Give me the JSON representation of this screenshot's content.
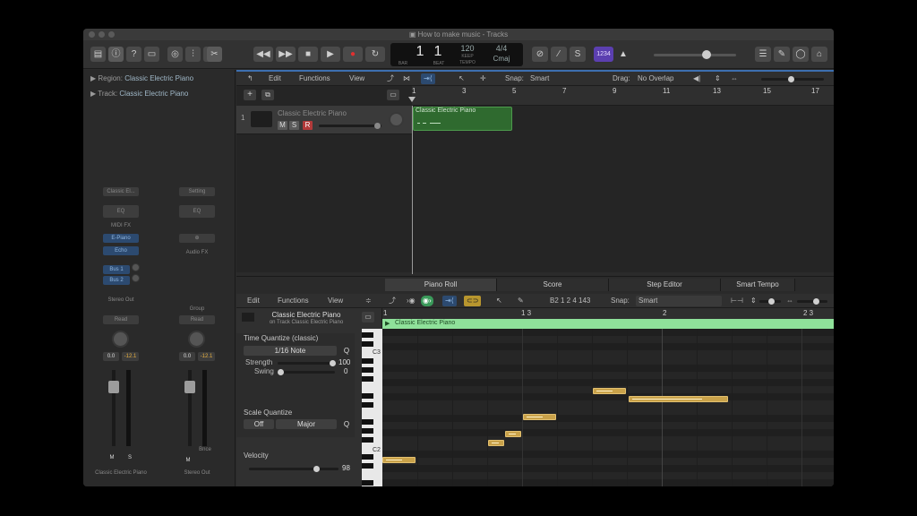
{
  "window": {
    "title": "How to make music - Tracks"
  },
  "lcd": {
    "bar": "1",
    "beat": "1",
    "tempo": "120",
    "tempo_label": "KEEP",
    "signature": "4/4",
    "key": "Cmaj",
    "bar_label": "BAR",
    "beat_label": "BEAT",
    "tempo_lab": "TEMPO"
  },
  "cpu_badge": "1234",
  "inspector": {
    "region_label": "Region:",
    "region_value": "Classic Electric Piano",
    "track_label": "Track:",
    "track_value": "Classic Electric Piano",
    "strip1": {
      "name": "Classic Electric Piano",
      "setting": "Classic El...",
      "eq": "EQ",
      "midi_fx": "MIDI FX",
      "plugin1": "E-Piano",
      "plugin2": "Echo",
      "send1": "Bus 1",
      "send2": "Bus 2",
      "output": "Stereo Out",
      "mode": "Read",
      "vol": "0.0",
      "peak": "-12.1",
      "mute": "M",
      "solo": "S"
    },
    "strip2": {
      "name": "Stereo Out",
      "setting": "Setting",
      "eq": "EQ",
      "link": "⊕",
      "audio_fx": "Audio FX",
      "group": "Group",
      "mode": "Read",
      "vol": "0.0",
      "peak": "-12.1",
      "mute": "M",
      "bnce": "Bnce"
    }
  },
  "tracks_toolbar": {
    "edit": "Edit",
    "functions": "Functions",
    "view": "View",
    "snap_label": "Snap:",
    "snap_value": "Smart",
    "drag_label": "Drag:",
    "drag_value": "No Overlap"
  },
  "ruler_marks": [
    "1",
    "3",
    "5",
    "7",
    "9",
    "11",
    "13",
    "15",
    "17"
  ],
  "track": {
    "number": "1",
    "name": "Classic Electric Piano",
    "m": "M",
    "s": "S",
    "r": "R"
  },
  "region_name": "Classic Electric Piano",
  "editor_tabs": [
    "Piano Roll",
    "Score",
    "Step Editor",
    "Smart Tempo"
  ],
  "pr_toolbar": {
    "edit": "Edit",
    "functions": "Functions",
    "view": "View",
    "position": "B2  1 2 4 143",
    "snap_label": "Snap:",
    "snap_value": "Smart"
  },
  "pr_region": {
    "name": "Classic Electric Piano",
    "track_line": "on Track Classic Electric Piano"
  },
  "time_quantize": {
    "title": "Time Quantize (classic)",
    "value": "1/16 Note",
    "q": "Q",
    "strength_label": "Strength",
    "strength_value": "100",
    "swing_label": "Swing",
    "swing_value": "0"
  },
  "scale_quantize": {
    "title": "Scale Quantize",
    "off": "Off",
    "scale": "Major",
    "q": "Q"
  },
  "velocity": {
    "title": "Velocity",
    "value": "98"
  },
  "pr_ruler_marks": [
    "1",
    "1 3",
    "2",
    "2 3"
  ],
  "key_labels": [
    "C3",
    "C2"
  ]
}
